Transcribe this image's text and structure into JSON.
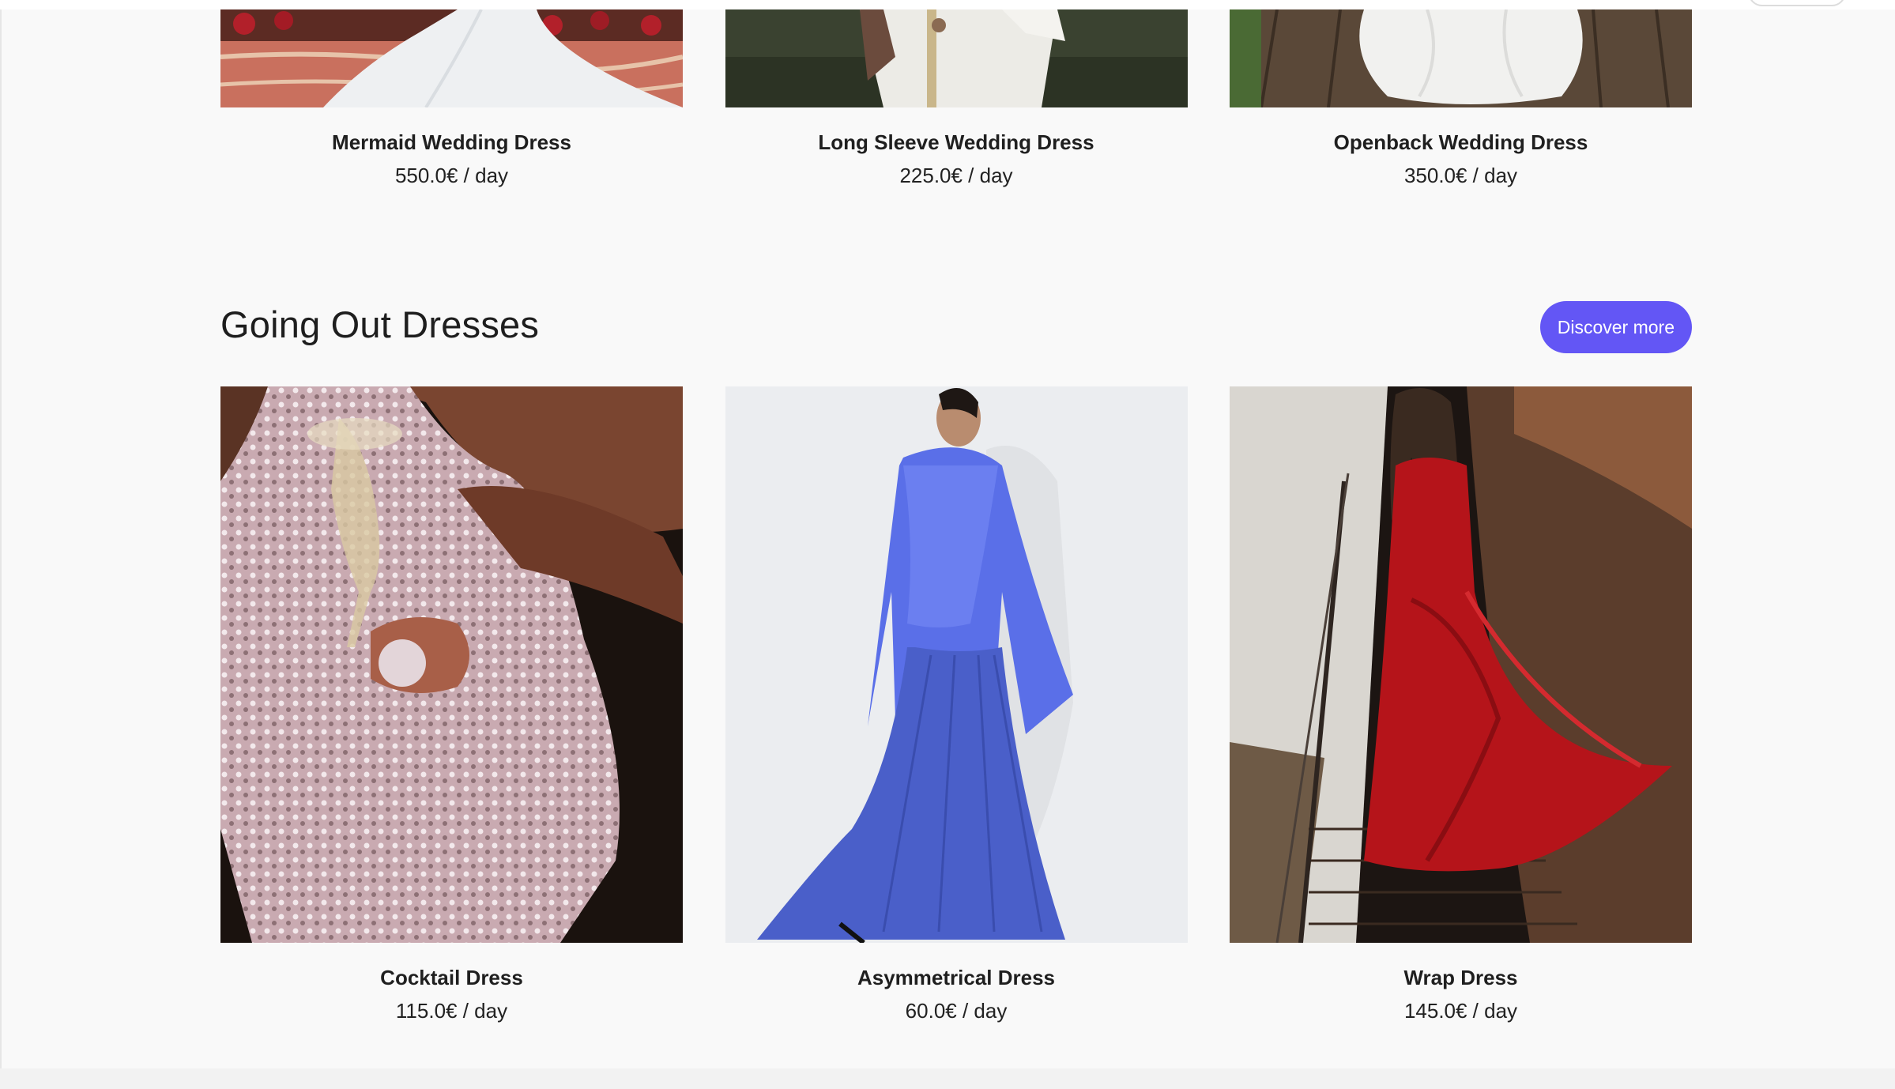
{
  "top_products": [
    {
      "name": "Mermaid Wedding Dress",
      "price": "550.0€ / day"
    },
    {
      "name": "Long Sleeve Wedding Dress",
      "price": "225.0€ / day"
    },
    {
      "name": "Openback Wedding Dress",
      "price": "350.0€ / day"
    }
  ],
  "section": {
    "title": "Going Out Dresses",
    "button_label": "Discover more"
  },
  "products": [
    {
      "name": "Cocktail Dress",
      "price": "115.0€ / day"
    },
    {
      "name": "Asymmetrical Dress",
      "price": "60.0€ / day"
    },
    {
      "name": "Wrap Dress",
      "price": "145.0€ / day"
    }
  ],
  "colors": {
    "accent": "#6356f5",
    "background": "#f9f9f9"
  }
}
